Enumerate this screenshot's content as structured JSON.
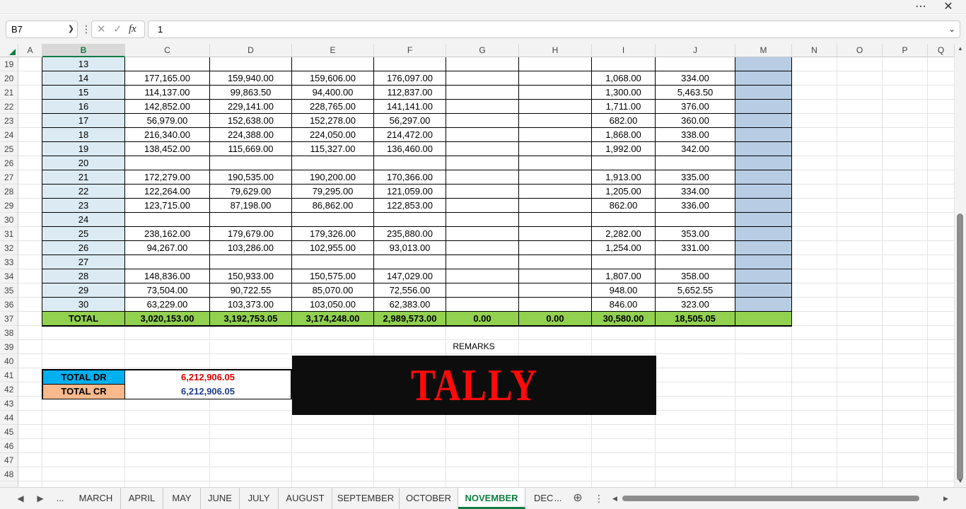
{
  "window": {
    "more_icon": "more-icon",
    "close_icon": "close-icon"
  },
  "formula_bar": {
    "name_box": "B7",
    "fx_label": "fx",
    "formula_value": "1"
  },
  "columns": [
    "A",
    "B",
    "C",
    "D",
    "E",
    "F",
    "G",
    "H",
    "I",
    "J",
    "M",
    "N",
    "O",
    "P",
    "Q"
  ],
  "rows": [
    "19",
    "20",
    "21",
    "22",
    "23",
    "24",
    "25",
    "26",
    "27",
    "28",
    "29",
    "30",
    "31",
    "32",
    "33",
    "34",
    "35",
    "36",
    "37",
    "38",
    "39",
    "40",
    "41",
    "42",
    "43",
    "44",
    "45",
    "46",
    "47",
    "48"
  ],
  "table": {
    "rows": [
      {
        "b": "13",
        "c": "",
        "d": "",
        "e": "",
        "f": "",
        "g": "",
        "h": "",
        "i": "",
        "j": ""
      },
      {
        "b": "14",
        "c": "177,165.00",
        "d": "159,940.00",
        "e": "159,606.00",
        "f": "176,097.00",
        "g": "",
        "h": "",
        "i": "1,068.00",
        "j": "334.00"
      },
      {
        "b": "15",
        "c": "114,137.00",
        "d": "99,863.50",
        "e": "94,400.00",
        "f": "112,837.00",
        "g": "",
        "h": "",
        "i": "1,300.00",
        "j": "5,463.50"
      },
      {
        "b": "16",
        "c": "142,852.00",
        "d": "229,141.00",
        "e": "228,765.00",
        "f": "141,141.00",
        "g": "",
        "h": "",
        "i": "1,711.00",
        "j": "376.00"
      },
      {
        "b": "17",
        "c": "56,979.00",
        "d": "152,638.00",
        "e": "152,278.00",
        "f": "56,297.00",
        "g": "",
        "h": "",
        "i": "682.00",
        "j": "360.00"
      },
      {
        "b": "18",
        "c": "216,340.00",
        "d": "224,388.00",
        "e": "224,050.00",
        "f": "214,472.00",
        "g": "",
        "h": "",
        "i": "1,868.00",
        "j": "338.00"
      },
      {
        "b": "19",
        "c": "138,452.00",
        "d": "115,669.00",
        "e": "115,327.00",
        "f": "136,460.00",
        "g": "",
        "h": "",
        "i": "1,992.00",
        "j": "342.00"
      },
      {
        "b": "20",
        "c": "",
        "d": "",
        "e": "",
        "f": "",
        "g": "",
        "h": "",
        "i": "",
        "j": ""
      },
      {
        "b": "21",
        "c": "172,279.00",
        "d": "190,535.00",
        "e": "190,200.00",
        "f": "170,366.00",
        "g": "",
        "h": "",
        "i": "1,913.00",
        "j": "335.00"
      },
      {
        "b": "22",
        "c": "122,264.00",
        "d": "79,629.00",
        "e": "79,295.00",
        "f": "121,059.00",
        "g": "",
        "h": "",
        "i": "1,205.00",
        "j": "334.00"
      },
      {
        "b": "23",
        "c": "123,715.00",
        "d": "87,198.00",
        "e": "86,862.00",
        "f": "122,853.00",
        "g": "",
        "h": "",
        "i": "862.00",
        "j": "336.00"
      },
      {
        "b": "24",
        "c": "",
        "d": "",
        "e": "",
        "f": "",
        "g": "",
        "h": "",
        "i": "",
        "j": ""
      },
      {
        "b": "25",
        "c": "238,162.00",
        "d": "179,679.00",
        "e": "179,326.00",
        "f": "235,880.00",
        "g": "",
        "h": "",
        "i": "2,282.00",
        "j": "353.00"
      },
      {
        "b": "26",
        "c": "94,267.00",
        "d": "103,286.00",
        "e": "102,955.00",
        "f": "93,013.00",
        "g": "",
        "h": "",
        "i": "1,254.00",
        "j": "331.00"
      },
      {
        "b": "27",
        "c": "",
        "d": "",
        "e": "",
        "f": "",
        "g": "",
        "h": "",
        "i": "",
        "j": ""
      },
      {
        "b": "28",
        "c": "148,836.00",
        "d": "150,933.00",
        "e": "150,575.00",
        "f": "147,029.00",
        "g": "",
        "h": "",
        "i": "1,807.00",
        "j": "358.00"
      },
      {
        "b": "29",
        "c": "73,504.00",
        "d": "90,722.55",
        "e": "85,070.00",
        "f": "72,556.00",
        "g": "",
        "h": "",
        "i": "948.00",
        "j": "5,652.55"
      },
      {
        "b": "30",
        "c": "63,229.00",
        "d": "103,373.00",
        "e": "103,050.00",
        "f": "62,383.00",
        "g": "",
        "h": "",
        "i": "846.00",
        "j": "323.00"
      }
    ],
    "total": {
      "b": "TOTAL",
      "c": "3,020,153.00",
      "d": "3,192,753.05",
      "e": "3,174,248.00",
      "f": "2,989,573.00",
      "g": "0.00",
      "h": "0.00",
      "i": "30,580.00",
      "j": "18,505.05"
    }
  },
  "summary": {
    "dr_label": "TOTAL DR",
    "dr_value": "6,212,906.05",
    "cr_label": "TOTAL CR",
    "cr_value": "6,212,906.05",
    "remarks_label": "REMARKS",
    "remarks_text": "TALLY"
  },
  "sheet_tabs": [
    "MARCH",
    "APRIL",
    "MAY",
    "JUNE",
    "JULY",
    "AUGUST",
    "SEPTEMBER",
    "OCTOBER",
    "NOVEMBER",
    "DEC"
  ],
  "active_tab": "NOVEMBER",
  "tab_overflow": "...",
  "colors": {
    "accent": "#107c41",
    "b_column_fill": "#dcebf3",
    "m_column_fill": "#b8cce4",
    "total_row_fill": "#92d050",
    "dr_label_fill": "#00b0f0",
    "cr_label_fill": "#f8b98c",
    "dr_value_color": "#e00000",
    "cr_value_color": "#1f3c88",
    "remarks_bg": "#0d0d0d",
    "remarks_text_color": "#ff0a0a"
  }
}
